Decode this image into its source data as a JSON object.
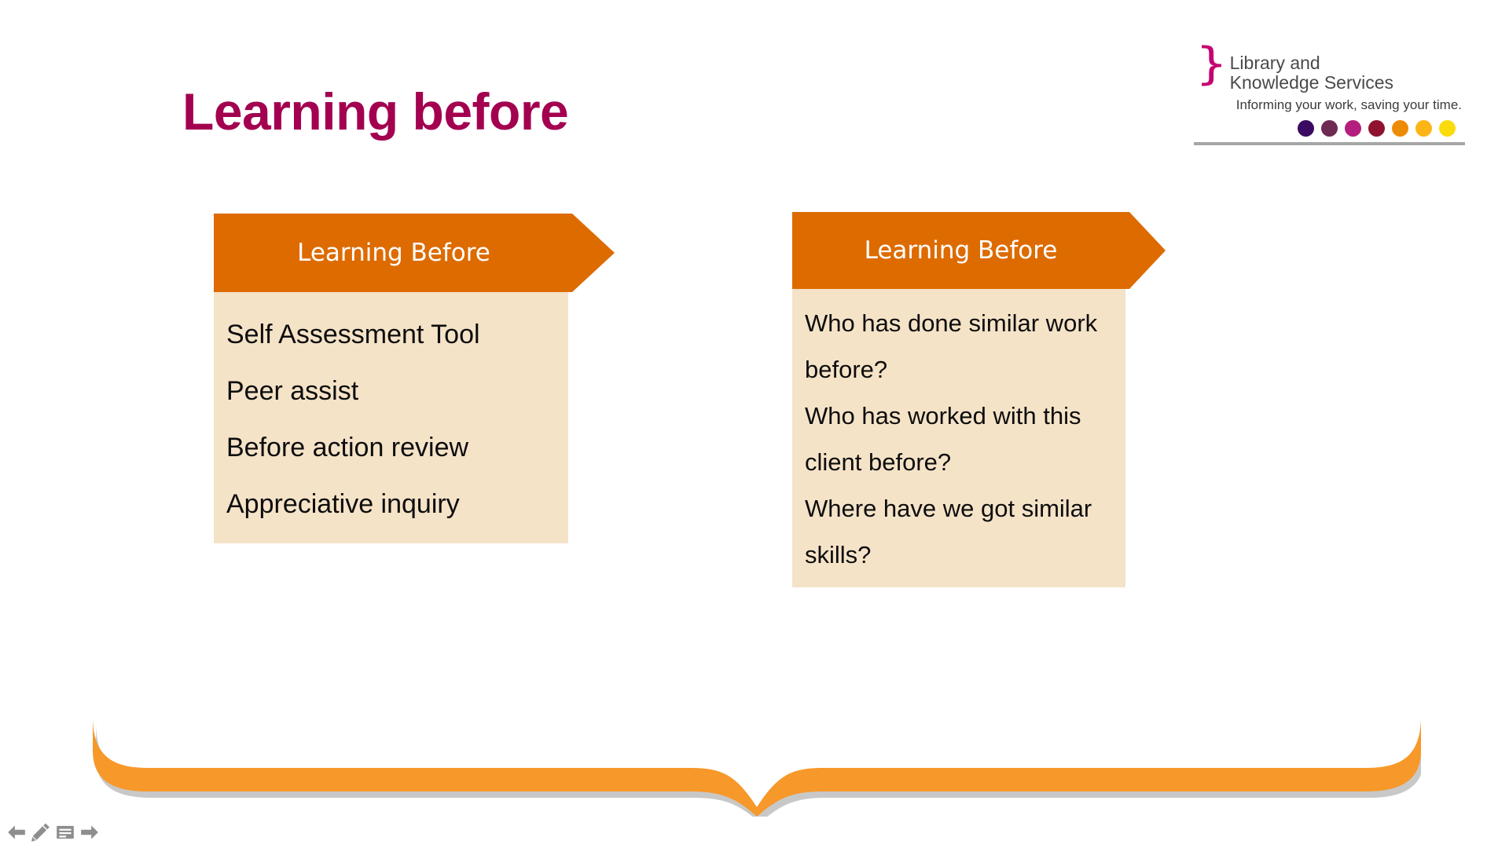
{
  "slide": {
    "title": "Learning before",
    "title_color": "#A30050",
    "background": "#FFFFFF"
  },
  "logo": {
    "brace_glyph": "}",
    "brace_color": "#C6006F",
    "name_line_1": "Library and",
    "name_line_2": "Knowledge Services",
    "tagline": "Informing your work, saving your time.",
    "rule_color": "#A6A6A6",
    "dots": [
      {
        "name": "dot-dark-purple",
        "color": "#3B0A63"
      },
      {
        "name": "dot-plum",
        "color": "#6E2A52"
      },
      {
        "name": "dot-magenta",
        "color": "#B41E7E"
      },
      {
        "name": "dot-dark-red",
        "color": "#90122F"
      },
      {
        "name": "dot-orange",
        "color": "#EE8B06"
      },
      {
        "name": "dot-amber",
        "color": "#FDB515"
      },
      {
        "name": "dot-yellow",
        "color": "#FADB0C"
      }
    ]
  },
  "cards": [
    {
      "id": "card-one",
      "header": "Learning Before",
      "header_color": "#DD6B00",
      "body_color": "#F5E3C8",
      "lines": [
        "Self Assessment Tool",
        "Peer assist",
        "Before action review",
        "Appreciative inquiry"
      ]
    },
    {
      "id": "card-two",
      "header": "Learning Before",
      "header_color": "#DD6B00",
      "body_color": "#F5E3C8",
      "lines": [
        "Who has done similar work",
        "before?",
        "Who has worked with this",
        "client before?",
        "Where have we got similar",
        "skills?"
      ]
    }
  ],
  "ribbon": {
    "name": "decorative-banner",
    "color": "#F7982A",
    "shadow_color": "#9B9B9B"
  },
  "toolbar": {
    "items": [
      {
        "name": "previous-slide-arrow-icon",
        "label": "Previous"
      },
      {
        "name": "pencil-annotate-icon",
        "label": "Annotate"
      },
      {
        "name": "notes-icon",
        "label": "Notes"
      },
      {
        "name": "next-slide-arrow-icon",
        "label": "Next"
      }
    ]
  }
}
